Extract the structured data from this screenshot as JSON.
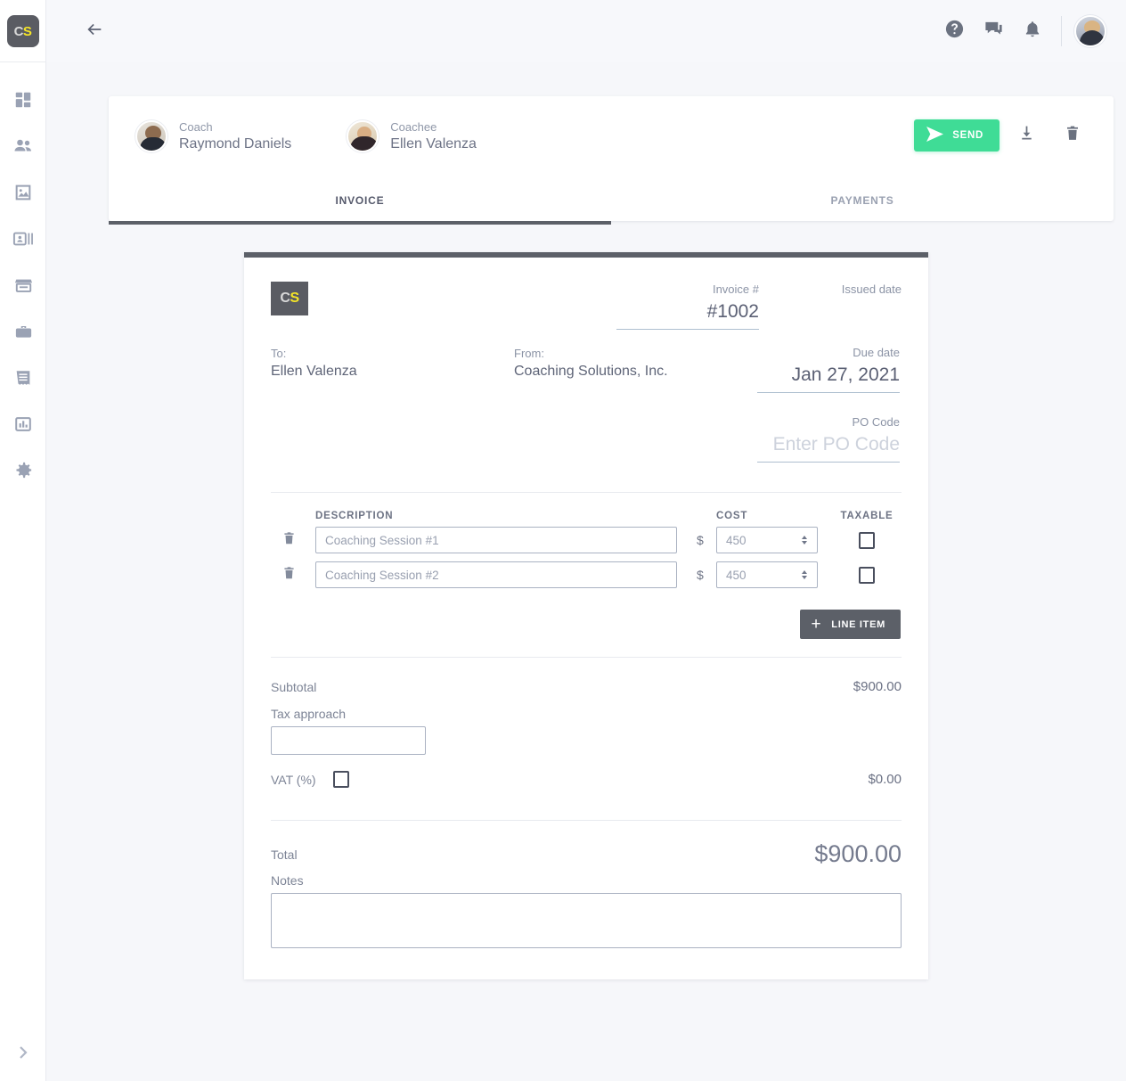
{
  "sidebar": {
    "logo": {
      "first": "C",
      "second": "S"
    },
    "items": [
      {
        "name": "dashboard",
        "icon": "dashboard-icon"
      },
      {
        "name": "people",
        "icon": "people-icon"
      },
      {
        "name": "media",
        "icon": "image-icon"
      },
      {
        "name": "contacts",
        "icon": "contact-card-icon"
      },
      {
        "name": "store",
        "icon": "store-icon"
      },
      {
        "name": "briefcase",
        "icon": "briefcase-icon"
      },
      {
        "name": "invoices",
        "icon": "receipt-icon"
      },
      {
        "name": "reports",
        "icon": "bar-chart-icon"
      },
      {
        "name": "settings",
        "icon": "gear-icon"
      }
    ],
    "expand": "expand-sidebar-icon"
  },
  "topbar": {
    "back": "back-arrow-icon",
    "help": "help-icon",
    "messages": "chat-icon",
    "notifications": "bell-icon",
    "avatar": "user-avatar"
  },
  "header_card": {
    "coach": {
      "role": "Coach",
      "name": "Raymond Daniels"
    },
    "coachee": {
      "role": "Coachee",
      "name": "Ellen Valenza"
    },
    "send_label": "SEND",
    "download": "download-icon",
    "delete": "trash-icon",
    "tabs": [
      {
        "label": "INVOICE",
        "active": true
      },
      {
        "label": "PAYMENTS",
        "active": false
      }
    ]
  },
  "invoice": {
    "logo": {
      "first": "C",
      "second": "S"
    },
    "invoice_number_label": "Invoice #",
    "invoice_number_value": "#1002",
    "issued_date_label": "Issued date",
    "issued_date_value": "",
    "to_label": "To:",
    "to_value": "Ellen Valenza",
    "from_label": "From:",
    "from_value": "Coaching Solutions, Inc.",
    "due_date_label": "Due date",
    "due_date_value": "Jan 27, 2021",
    "po_code_label": "PO Code",
    "po_code_placeholder": "Enter PO Code",
    "columns": {
      "description": "DESCRIPTION",
      "cost": "COST",
      "taxable": "TAXABLE"
    },
    "currency_symbol": "$",
    "line_items": [
      {
        "description": "",
        "description_placeholder": "Coaching Session #1",
        "cost": "",
        "cost_placeholder": "450",
        "taxable": false
      },
      {
        "description": "",
        "description_placeholder": "Coaching Session #2",
        "cost": "",
        "cost_placeholder": "450",
        "taxable": false
      }
    ],
    "add_line_item_label": "LINE ITEM",
    "subtotal_label": "Subtotal",
    "subtotal_value": "$900.00",
    "tax_approach_label": "Tax approach",
    "tax_approach_value": "",
    "vat_label": "VAT (%)",
    "vat_value": "$0.00",
    "vat_checked": false,
    "total_label": "Total",
    "total_value": "$900.00",
    "notes_label": "Notes",
    "notes_value": ""
  },
  "colors": {
    "send_green": "#3fdc96",
    "dark_gray": "#5c6068",
    "logo_yellow": "#f5e527",
    "page_bg": "#f6f7fa"
  }
}
